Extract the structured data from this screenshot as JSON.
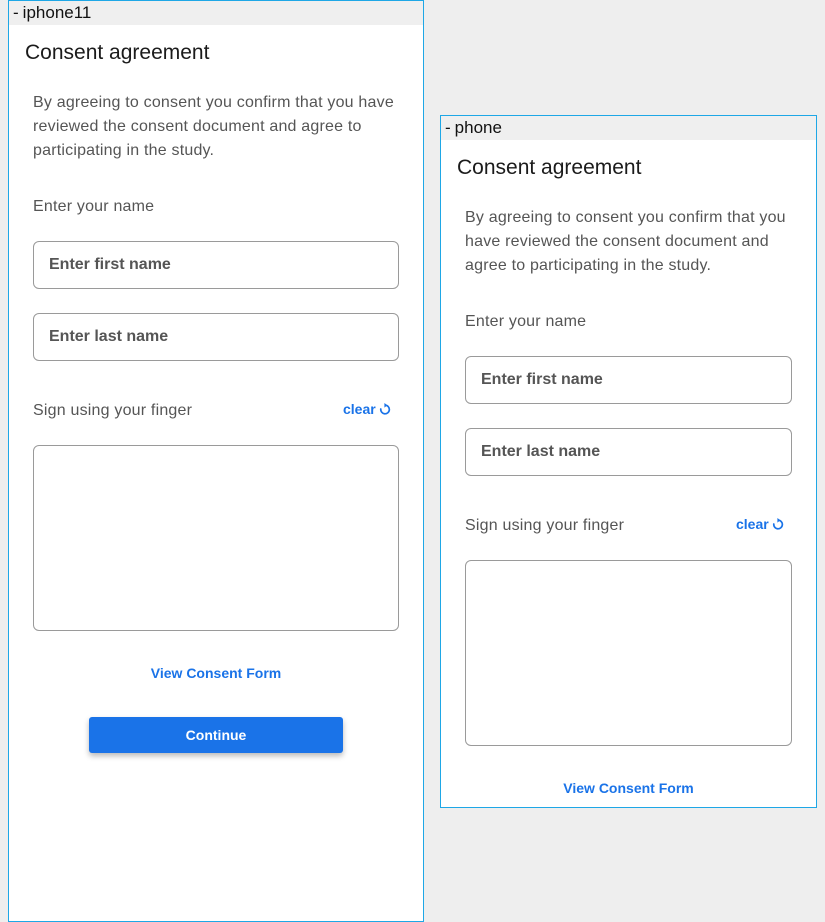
{
  "colors": {
    "accent": "#1a73e8",
    "frame_border": "#1ea7e6",
    "canvas_background": "#eeeeee"
  },
  "frames": {
    "iphone11": {
      "label": "iphone11",
      "title": "Consent agreement",
      "description": "By agreeing to consent you confirm that you have reviewed the consent document and agree to participating in the study.",
      "name_label": "Enter your name",
      "first_name": {
        "value": "",
        "placeholder": "Enter first name"
      },
      "last_name": {
        "value": "",
        "placeholder": "Enter last name"
      },
      "sign_label": "Sign using your finger",
      "clear_label": "clear",
      "clear_icon": "refresh-icon",
      "view_consent_label": "View Consent Form",
      "continue_label": "Continue"
    },
    "phone": {
      "label": "phone",
      "title": "Consent agreement",
      "description": "By agreeing to consent you confirm that you have reviewed the consent document and agree to participating in the study.",
      "name_label": "Enter your name",
      "first_name": {
        "value": "",
        "placeholder": "Enter first name"
      },
      "last_name": {
        "value": "",
        "placeholder": "Enter last name"
      },
      "sign_label": "Sign using your finger",
      "clear_label": "clear",
      "clear_icon": "refresh-icon",
      "view_consent_label": "View Consent Form"
    }
  }
}
